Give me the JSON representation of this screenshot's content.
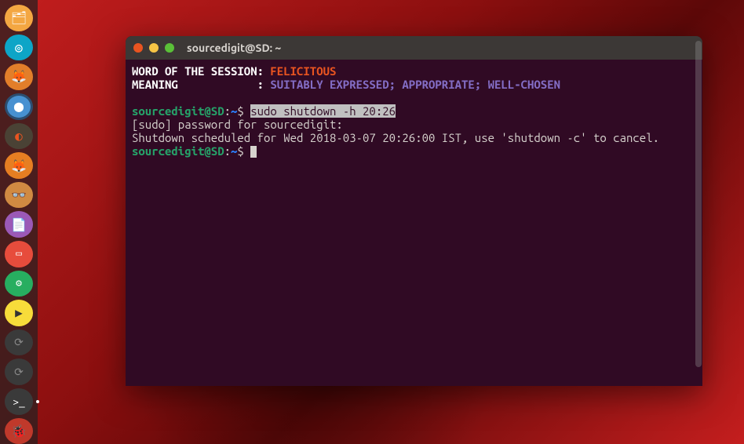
{
  "window": {
    "title": "sourcedigit@SD: ~"
  },
  "session": {
    "word_label": "WORD OF THE SESSION: ",
    "word_value": "FELICITOUS",
    "meaning_label": "MEANING            : ",
    "meaning_value": "SUITABLY EXPRESSED; APPROPRIATE; WELL-CHOSEN"
  },
  "prompt": {
    "user_host": "sourcedigit@SD",
    "colon": ":",
    "path": "~",
    "sigil": "$ "
  },
  "lines": {
    "command": "sudo shutdown -h 20:26",
    "sudo_prompt": "[sudo] password for sourcedigit:",
    "schedule": "Shutdown scheduled for Wed 2018-03-07 20:26:00 IST, use 'shutdown -c' to cancel."
  },
  "launcher": {
    "items": [
      {
        "id": "files"
      },
      {
        "id": "app2"
      },
      {
        "id": "firefox"
      },
      {
        "id": "chromium"
      },
      {
        "id": "app5"
      },
      {
        "id": "app6"
      },
      {
        "id": "app7"
      },
      {
        "id": "notes"
      },
      {
        "id": "slides"
      },
      {
        "id": "settings"
      },
      {
        "id": "media"
      },
      {
        "id": "app12"
      },
      {
        "id": "app13"
      },
      {
        "id": "terminal"
      },
      {
        "id": "app15"
      }
    ]
  }
}
